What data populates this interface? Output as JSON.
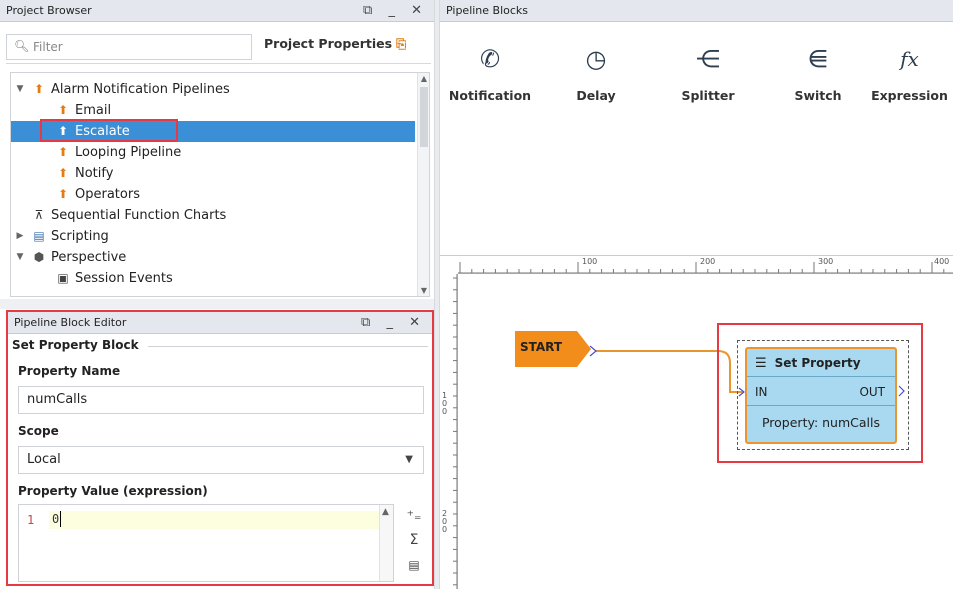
{
  "project_browser": {
    "title": "Project Browser",
    "window_controls": "⧉ _ ✕",
    "filter_placeholder": "Filter",
    "project_properties_label": "Project Properties",
    "tree": [
      {
        "label": "Alarm Notification Pipelines",
        "icon": "alarm-pipeline-icon",
        "expanded": true
      },
      {
        "label": "Email",
        "icon": "alarm-pipeline-icon"
      },
      {
        "label": "Escalate",
        "icon": "alarm-pipeline-icon",
        "selected": true
      },
      {
        "label": "Looping Pipeline",
        "icon": "alarm-pipeline-icon"
      },
      {
        "label": "Notify",
        "icon": "alarm-pipeline-icon"
      },
      {
        "label": "Operators",
        "icon": "alarm-pipeline-icon"
      },
      {
        "label": "Sequential Function Charts",
        "icon": "sfc-icon"
      },
      {
        "label": "Scripting",
        "icon": "script-icon",
        "expanded": false
      },
      {
        "label": "Perspective",
        "icon": "perspective-icon",
        "expanded": true
      },
      {
        "label": "Session Events",
        "icon": "session-events-icon"
      }
    ]
  },
  "block_editor": {
    "title": "Pipeline Block Editor",
    "window_controls": "⧉ _ ✕",
    "section_title": "Set Property Block",
    "property_name_label": "Property Name",
    "property_name_value": "numCalls",
    "scope_label": "Scope",
    "scope_value": "Local",
    "property_value_label": "Property Value (expression)",
    "expression_line_number": "1",
    "expression_code": "0"
  },
  "pipeline_blocks": {
    "title": "Pipeline Blocks",
    "blocks": [
      {
        "label": "Notification",
        "icon": "notification-phone-icon"
      },
      {
        "label": "Delay",
        "icon": "clock-icon"
      },
      {
        "label": "Splitter",
        "icon": "splitter-icon"
      },
      {
        "label": "Switch",
        "icon": "switch-icon"
      },
      {
        "label": "Expression",
        "icon": "fx-icon"
      }
    ]
  },
  "canvas": {
    "ruler_top": [
      "100",
      "200",
      "300",
      "400"
    ],
    "ruler_left": [
      "100",
      "200"
    ],
    "start_label": "START",
    "set_property_block": {
      "title": "Set Property",
      "in_label": "IN",
      "out_label": "OUT",
      "property_text": "Property: numCalls"
    }
  },
  "colors": {
    "selection": "#3b8fd6",
    "highlight_red": "#e53944",
    "start_orange": "#f28c1a",
    "block_fill": "#a8d9f0",
    "block_border": "#e8962d"
  }
}
